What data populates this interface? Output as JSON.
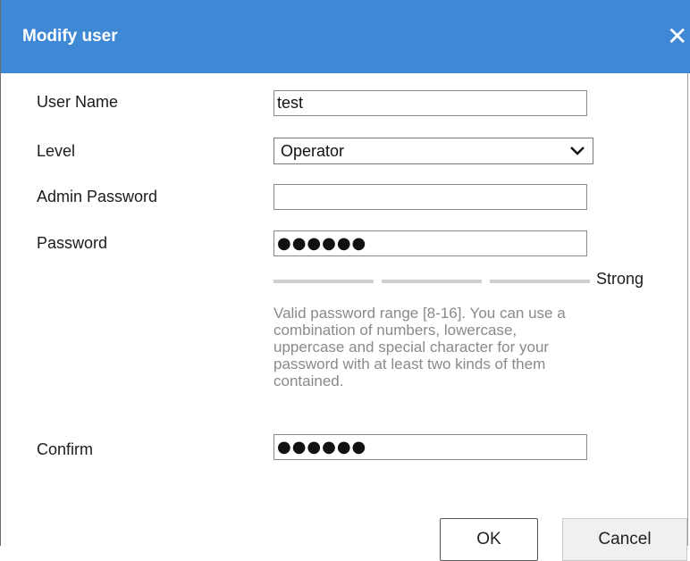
{
  "dialog": {
    "title": "Modify user",
    "close_icon": "close-icon"
  },
  "form": {
    "username_label": "User Name",
    "username_value": "test",
    "level_label": "Level",
    "level_value": "Operator",
    "admin_password_label": "Admin Password",
    "admin_password_value": "",
    "password_label": "Password",
    "password_value": "●●●●●●",
    "strength_label": "Strong",
    "hint_text": "Valid password range [8-16]. You can use a combination of numbers, lowercase, uppercase and special character for your password with at least two kinds of them contained.",
    "confirm_label": "Confirm",
    "confirm_value": "●●●●●●"
  },
  "buttons": {
    "ok_label": "OK",
    "cancel_label": "Cancel"
  },
  "colors": {
    "titlebar": "#3f88d6",
    "strength_inactive": "#cfcfcf",
    "hint_text": "#8a8a8a"
  }
}
